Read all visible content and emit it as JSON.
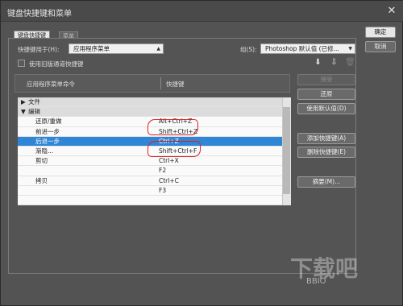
{
  "window": {
    "title": "键盘快捷键和菜单"
  },
  "tabs": [
    {
      "label": "键盘快捷键"
    },
    {
      "label": "菜单"
    }
  ],
  "shortcuts_for": {
    "label": "快捷键用于(H):",
    "value": "应用程序菜单"
  },
  "set": {
    "label": "组(S):",
    "value": "Photoshop 默认值 (已修..."
  },
  "legacy_channel": {
    "label": "使用旧版通道快捷键",
    "checked": false
  },
  "table": {
    "headers": {
      "command": "应用程序菜单命令",
      "shortcut": "快捷键"
    },
    "rows": [
      {
        "command": "文件",
        "shortcut": "",
        "type": "group",
        "expand": "▶"
      },
      {
        "command": "编辑",
        "shortcut": "",
        "type": "group",
        "expand": "▼"
      },
      {
        "command": "还原/重做",
        "shortcut": "Alt+Ctrl+Z",
        "type": "item"
      },
      {
        "command": "前进一步",
        "shortcut": "Shift+Ctrl+Z",
        "type": "item"
      },
      {
        "command": "后退一步",
        "shortcut": "Ctrl+Z",
        "type": "selected"
      },
      {
        "command": "渐隐...",
        "shortcut": "Shift+Ctrl+F",
        "type": "item"
      },
      {
        "command": "剪切",
        "shortcut": "Ctrl+X",
        "type": "item"
      },
      {
        "command": "",
        "shortcut": "F2",
        "type": "item"
      },
      {
        "command": "拷贝",
        "shortcut": "Ctrl+C",
        "type": "item"
      },
      {
        "command": "",
        "shortcut": "F3",
        "type": "item"
      },
      {
        "command": "",
        "shortcut": "",
        "type": "item"
      }
    ]
  },
  "buttons": {
    "ok": "确定",
    "cancel": "取消",
    "accept": "接受",
    "restore": "还原",
    "use_default": "使用默认值(D)",
    "add_shortcut": "添加快捷键(A)",
    "delete_shortcut": "删除快捷键(E)",
    "summarize": "摘要(M)..."
  },
  "icons": {
    "save_set": "save-set-icon",
    "save_set_as": "save-set-as-icon",
    "delete_set": "trash-icon"
  },
  "watermark": {
    "text": "下载吧",
    "sub": "BBIO"
  },
  "colors": {
    "selection": "#2f86d6",
    "annotation": "#e02020",
    "panel": "#535353"
  }
}
